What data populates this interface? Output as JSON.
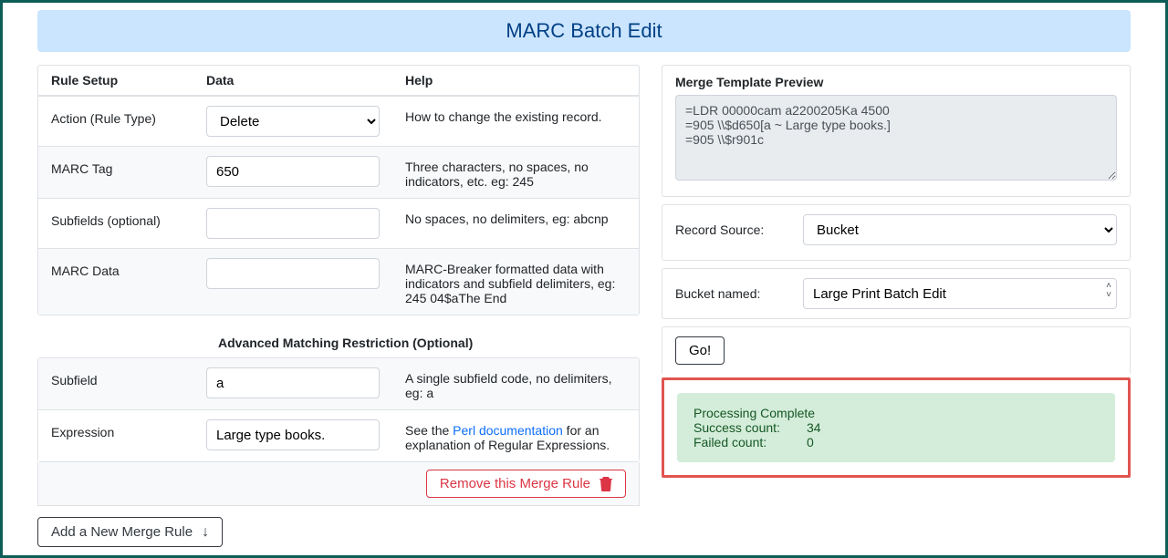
{
  "page_title": "MARC Batch Edit",
  "headers": {
    "rule_setup": "Rule Setup",
    "data": "Data",
    "help": "Help"
  },
  "rows": {
    "action": {
      "label": "Action (Rule Type)",
      "value": "Delete",
      "help": "How to change the existing record."
    },
    "tag": {
      "label": "MARC Tag",
      "value": "650",
      "help": "Three characters, no spaces, no indicators, etc. eg: 245"
    },
    "subfields": {
      "label": "Subfields (optional)",
      "value": "",
      "help": "No spaces, no delimiters, eg: abcnp"
    },
    "marcdata": {
      "label": "MARC Data",
      "value": "",
      "help": "MARC-Breaker formatted data with indicators and subfield delimiters, eg: 245 04$aThe End"
    }
  },
  "advanced_heading": "Advanced Matching Restriction (Optional)",
  "adv_rows": {
    "subfield": {
      "label": "Subfield",
      "value": "a",
      "help": "A single subfield code, no delimiters, eg: a"
    },
    "expr": {
      "label": "Expression",
      "value": "Large type books.",
      "help_pre": "See the ",
      "help_link": "Perl documentation",
      "help_post": " for an explanation of Regular Expressions."
    }
  },
  "buttons": {
    "remove_rule": "Remove this Merge Rule",
    "add_rule": "Add a New Merge Rule",
    "go": "Go!"
  },
  "preview": {
    "label": "Merge Template Preview",
    "text": "=LDR 00000cam a2200205Ka 4500\n=905 \\\\$d650[a ~ Large type books.]\n=905 \\\\$r901c"
  },
  "source": {
    "record_source_label": "Record Source:",
    "record_source_value": "Bucket",
    "bucket_label": "Bucket named:",
    "bucket_value": "Large Print Batch Edit"
  },
  "result": {
    "complete": "Processing Complete",
    "success_label": "Success count:",
    "success_value": "34",
    "failed_label": "Failed count:",
    "failed_value": "0"
  }
}
